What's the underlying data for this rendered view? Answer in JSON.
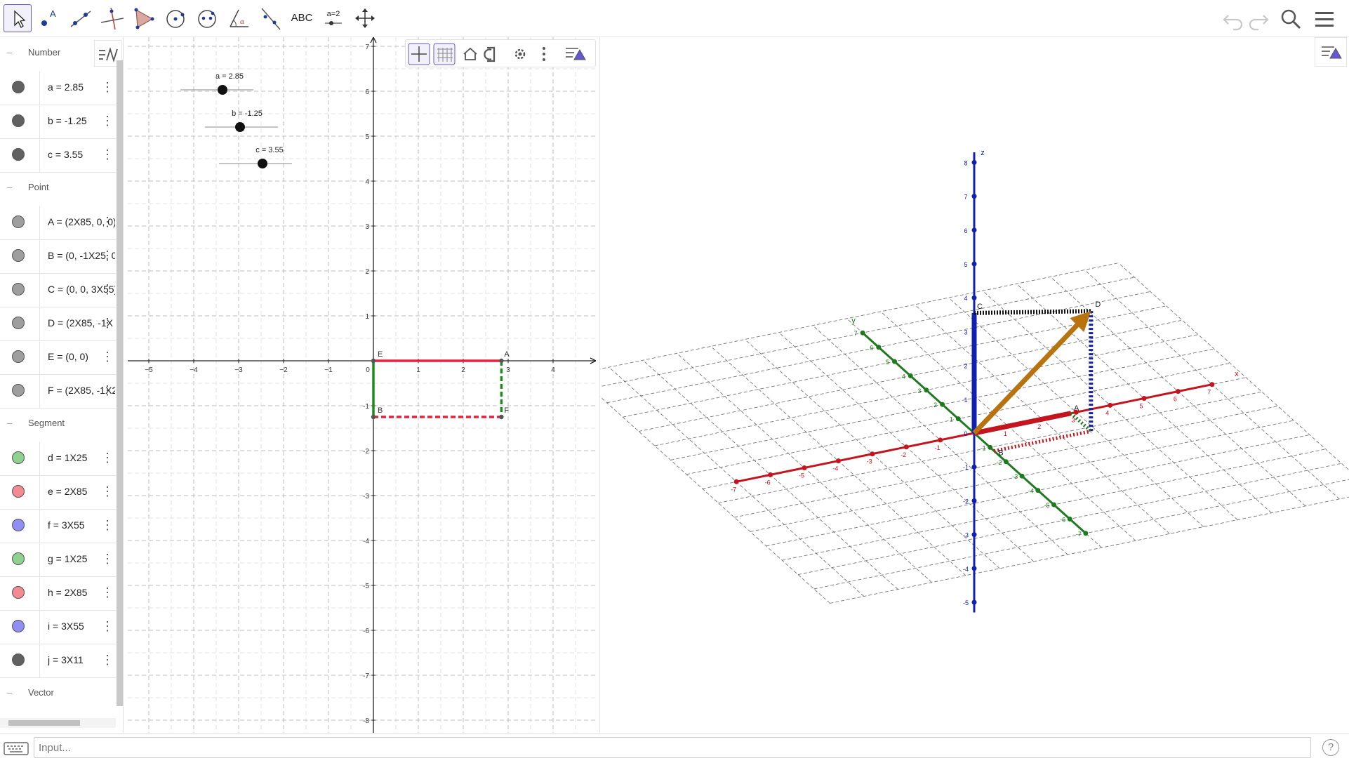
{
  "toolbar": {
    "tools": [
      {
        "name": "move-tool",
        "icon": "arrow-cursor-icon"
      },
      {
        "name": "point-tool",
        "icon": "point-icon",
        "label": "A"
      },
      {
        "name": "line-tool",
        "icon": "line-icon"
      },
      {
        "name": "perpendicular-line-tool",
        "icon": "perpendicular-icon"
      },
      {
        "name": "polygon-tool",
        "icon": "polygon-icon"
      },
      {
        "name": "circle-tool",
        "icon": "circle-center-icon"
      },
      {
        "name": "ellipse-tool",
        "icon": "ellipse-icon"
      },
      {
        "name": "angle-tool",
        "icon": "angle-icon",
        "label": "α"
      },
      {
        "name": "reflect-tool",
        "icon": "reflect-icon"
      },
      {
        "name": "text-tool",
        "icon": "text-icon",
        "label": "ABC"
      },
      {
        "name": "slider-tool",
        "icon": "slider-icon",
        "label": "a=2"
      },
      {
        "name": "move-graphics-tool",
        "icon": "move-view-icon"
      }
    ],
    "right": [
      "undo-icon",
      "redo-icon",
      "search-icon",
      "menu-icon"
    ]
  },
  "algebra": {
    "groups": [
      {
        "title": "Number",
        "items": [
          {
            "expr": "a = 2.85",
            "color": "#616161"
          },
          {
            "expr": "b = -1.25",
            "color": "#616161"
          },
          {
            "expr": "c = 3.55",
            "color": "#616161"
          }
        ]
      },
      {
        "title": "Point",
        "items": [
          {
            "expr": "A = (2X85, 0, 0)",
            "color": "#9e9e9e"
          },
          {
            "expr": "B = (0, -1X25, 0)",
            "color": "#9e9e9e"
          },
          {
            "expr": "C = (0, 0, 3X55)",
            "color": "#9e9e9e"
          },
          {
            "expr": "D = (2X85, -1X",
            "color": "#9e9e9e"
          },
          {
            "expr": "E = (0, 0)",
            "color": "#9e9e9e"
          },
          {
            "expr": "F = (2X85, -1X2",
            "color": "#9e9e9e"
          }
        ]
      },
      {
        "title": "Segment",
        "items": [
          {
            "expr": "d = 1X25",
            "color": "#8fd18f"
          },
          {
            "expr": "e = 2X85",
            "color": "#f48a92"
          },
          {
            "expr": "f = 3X55",
            "color": "#8f8ff5"
          },
          {
            "expr": "g = 1X25",
            "color": "#8fd18f"
          },
          {
            "expr": "h = 2X85",
            "color": "#f48a92"
          },
          {
            "expr": "i = 3X55",
            "color": "#8f8ff5"
          },
          {
            "expr": "j = 3X11",
            "color": "#616161"
          }
        ]
      },
      {
        "title": "Vector",
        "items": []
      }
    ]
  },
  "graphics2d": {
    "x_ticks": [
      "−5",
      "−4",
      "−3",
      "−2",
      "−1",
      "0",
      "1",
      "2",
      "3",
      "4"
    ],
    "y_ticks": [
      "7",
      "6",
      "5",
      "4",
      "3",
      "2",
      "1",
      "-1",
      "-2",
      "-3",
      "-4",
      "-5",
      "-6",
      "-7",
      "-8"
    ],
    "sliders": [
      {
        "label": "a = 2.85",
        "value": 2.85
      },
      {
        "label": "b = -1.25",
        "value": -1.25
      },
      {
        "label": "c = 3.55",
        "value": 3.55
      }
    ],
    "point_labels": [
      "E",
      "A",
      "B",
      "F"
    ],
    "colors": {
      "red": "#e8203c",
      "green": "#1e8a1e",
      "axis": "#222222",
      "grid": "#bdbdbd"
    }
  },
  "graphics3d": {
    "axis_labels": {
      "x": "x",
      "y": "y",
      "z": "z"
    },
    "z_ticks": [
      "8",
      "7",
      "6",
      "5",
      "4",
      "3",
      "2",
      "1",
      "0",
      "-1",
      "-2",
      "-3",
      "-4",
      "-5"
    ],
    "x_ticks": [
      "-7",
      "-6",
      "-5",
      "-4",
      "-3",
      "-2",
      "-1",
      "1",
      "2",
      "3",
      "4",
      "5",
      "6",
      "7"
    ],
    "y_ticks": [
      "1",
      "2",
      "3",
      "4",
      "5",
      "6",
      "7",
      "-1",
      "-2",
      "-3",
      "-4",
      "-5",
      "-6",
      "-7"
    ],
    "point_labels": [
      "C",
      "D",
      "B",
      "A"
    ],
    "colors": {
      "x_axis": "#c4141e",
      "y_axis": "#1f7a1f",
      "z_axis": "#1020b0",
      "vector": "#b8730f"
    }
  },
  "input": {
    "placeholder": "Input..."
  }
}
